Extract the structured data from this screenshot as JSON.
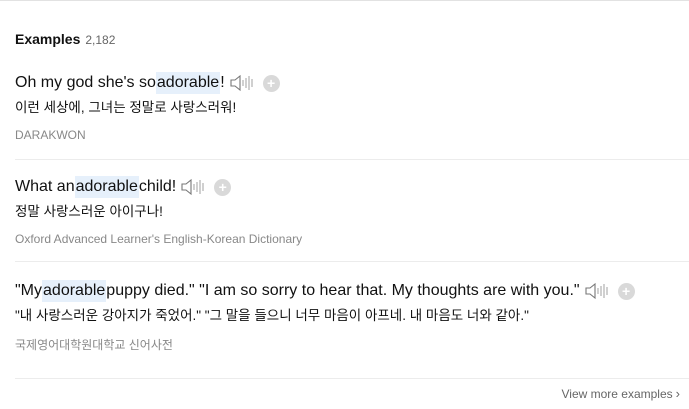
{
  "header": {
    "title": "Examples",
    "count": "2,182"
  },
  "examples": [
    {
      "sentence_before": "Oh my god she's so ",
      "highlight": "adorable",
      "sentence_after": "!",
      "translation": "이런 세상에, 그녀는 정말로 사랑스러워!",
      "source": "DARAKWON"
    },
    {
      "sentence_before": "What an ",
      "highlight": "adorable",
      "sentence_after": " child!",
      "translation": "정말 사랑스러운 아이구나!",
      "source": "Oxford Advanced Learner's English-Korean Dictionary"
    },
    {
      "sentence_before": "\"My ",
      "highlight": "adorable",
      "sentence_after": " puppy died.\" \"I am so sorry to hear that. My thoughts are with you.\"",
      "translation": "\"내 사랑스러운 강아지가 죽었어.\" \"그 말을 들으니 너무 마음이 아프네. 내 마음도 너와 같아.\"",
      "source": "국제영어대학원대학교 신어사전"
    }
  ],
  "icons": {
    "play": "speaker-icon",
    "add": "plus-icon",
    "more": "chevron-right-icon"
  },
  "plus_symbol": "+",
  "view_more": {
    "label": "View more examples",
    "chevron": "›"
  },
  "colors": {
    "highlight": "#e6f0fb",
    "source_text": "#888888",
    "plus_bg": "#d9d9d9"
  }
}
